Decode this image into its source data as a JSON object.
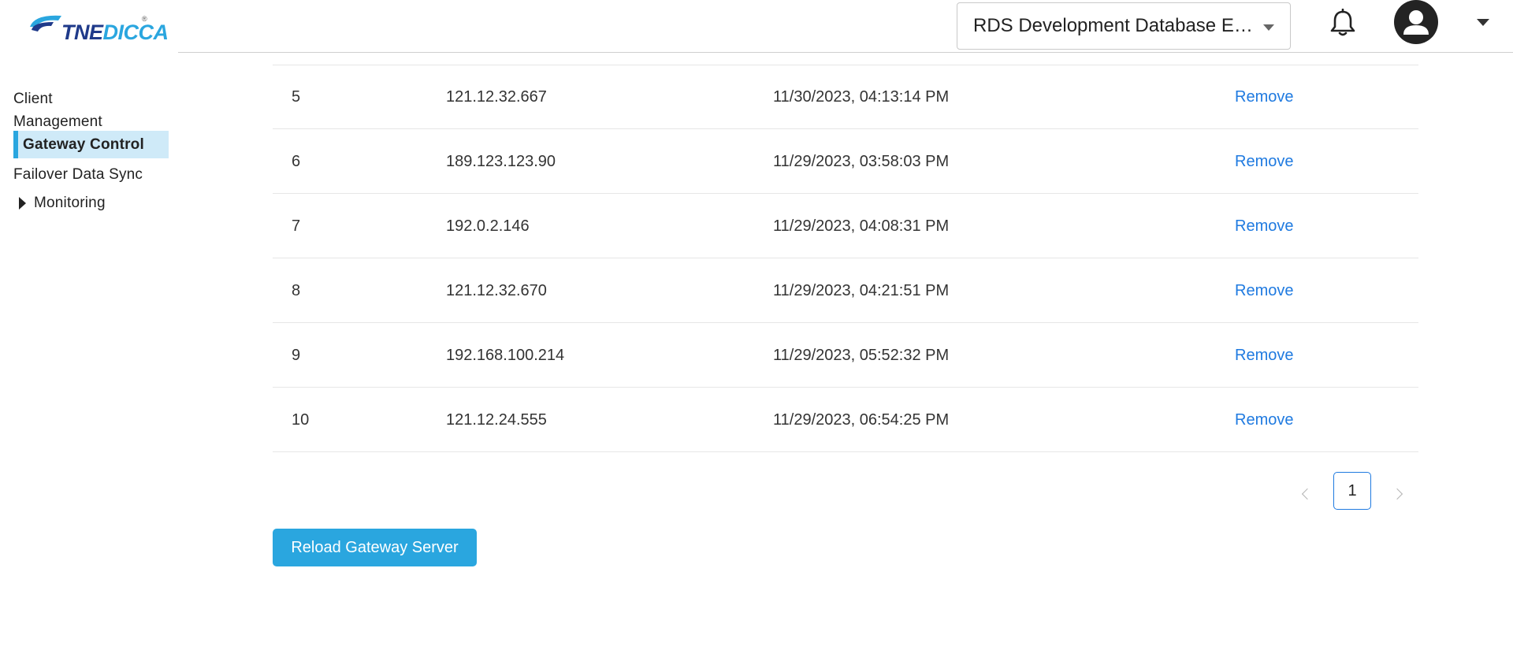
{
  "brand": {
    "logo_text_part1": "TNE",
    "logo_text_part2": "DICCA",
    "registered": "®"
  },
  "header": {
    "database_select_value": "RDS Development Database EL...",
    "icons": {
      "notifications": "bell-icon",
      "user": "avatar-icon",
      "user_menu": "chevron-down-icon",
      "db_select": "chevron-down-icon"
    }
  },
  "sidebar": {
    "items": [
      {
        "label": "Client Management",
        "active": false
      },
      {
        "label": "Gateway Control",
        "active": true
      },
      {
        "label": "Failover Data Sync",
        "active": false
      },
      {
        "label": "Monitoring",
        "active": false,
        "expandable": true
      }
    ]
  },
  "table": {
    "rows": [
      {
        "num": "5",
        "ip": "121.12.32.667",
        "time": "11/30/2023, 04:13:14 PM",
        "action": "Remove"
      },
      {
        "num": "6",
        "ip": "189.123.123.90",
        "time": "11/29/2023, 03:58:03 PM",
        "action": "Remove"
      },
      {
        "num": "7",
        "ip": "192.0.2.146",
        "time": "11/29/2023, 04:08:31 PM",
        "action": "Remove"
      },
      {
        "num": "8",
        "ip": "121.12.32.670",
        "time": "11/29/2023, 04:21:51 PM",
        "action": "Remove"
      },
      {
        "num": "9",
        "ip": "192.168.100.214",
        "time": "11/29/2023, 05:52:32 PM",
        "action": "Remove"
      },
      {
        "num": "10",
        "ip": "121.12.24.555",
        "time": "11/29/2023, 06:54:25 PM",
        "action": "Remove"
      }
    ]
  },
  "pagination": {
    "current_page": "1"
  },
  "actions": {
    "reload_label": "Reload Gateway Server"
  },
  "colors": {
    "accent": "#2aa6df",
    "link": "#1f7ae0",
    "active_bg": "#cfeaf8"
  }
}
